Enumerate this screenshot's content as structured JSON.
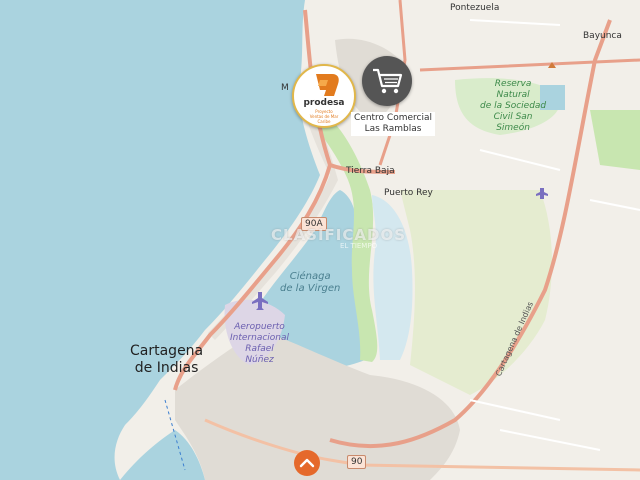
{
  "map": {
    "colors": {
      "water": "#aad3df",
      "land": "#f2efe9",
      "park": "#c8e6b0",
      "wetland": "#d9eccb",
      "primary_road": "#e8a08a",
      "urban": "#e0dcd5"
    },
    "places": {
      "pontezuela": "Pontezuela",
      "bayunca": "Bayunca",
      "tierra_baja": "Tierra Baja",
      "puerto_rey": "Puerto Rey",
      "cartagena": "Cartagena\nde Indias",
      "marker_m": "M"
    },
    "water_labels": {
      "cienaga": "Ciénaga\nde la Virgen"
    },
    "park_labels": {
      "reserva": "Reserva\nNatural\nde la Sociedad\nCivil San\nSimeón"
    },
    "airport_label": "Aeropuerto\nInternacional\nRafael\nNúñez",
    "road_shields": {
      "r90a": "90A",
      "r90": "90"
    },
    "road_labels": {
      "cartagena_de_indias": "Cartagena de Indias"
    }
  },
  "markers": {
    "prodesa": {
      "name": "prodesa",
      "sub": "Proyecto\nVentas de Mar\nCaribe",
      "icon": "prodesa-logo-icon"
    },
    "shop": {
      "icon": "shopping-cart-icon",
      "label": "Centro Comercial\nLas Ramblas"
    }
  },
  "watermark": {
    "text": "CLASIFICADOS",
    "sub": "EL TIEMPO"
  },
  "controls": {
    "scroll_up_icon": "chevron-up-icon"
  }
}
